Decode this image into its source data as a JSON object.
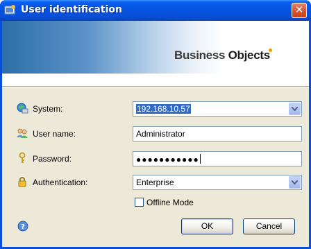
{
  "window": {
    "title": "User identification",
    "close_glyph": "✕"
  },
  "banner": {
    "logo_text_a": "Business ",
    "logo_text_b": "Objects"
  },
  "form": {
    "system": {
      "label": "System:",
      "value": "192.168.10.57"
    },
    "username": {
      "label": "User name:",
      "value": "Administrator"
    },
    "password": {
      "label": "Password:",
      "masked_value": "●●●●●●●●●●●"
    },
    "authentication": {
      "label": "Authentication:",
      "value": "Enterprise"
    },
    "offline": {
      "label": "Offline Mode",
      "checked": false
    }
  },
  "buttons": {
    "ok": "OK",
    "cancel": "Cancel"
  },
  "colors": {
    "titlebar": "#0a4fd8",
    "client_bg": "#ece9d8",
    "selection": "#316ac5"
  }
}
